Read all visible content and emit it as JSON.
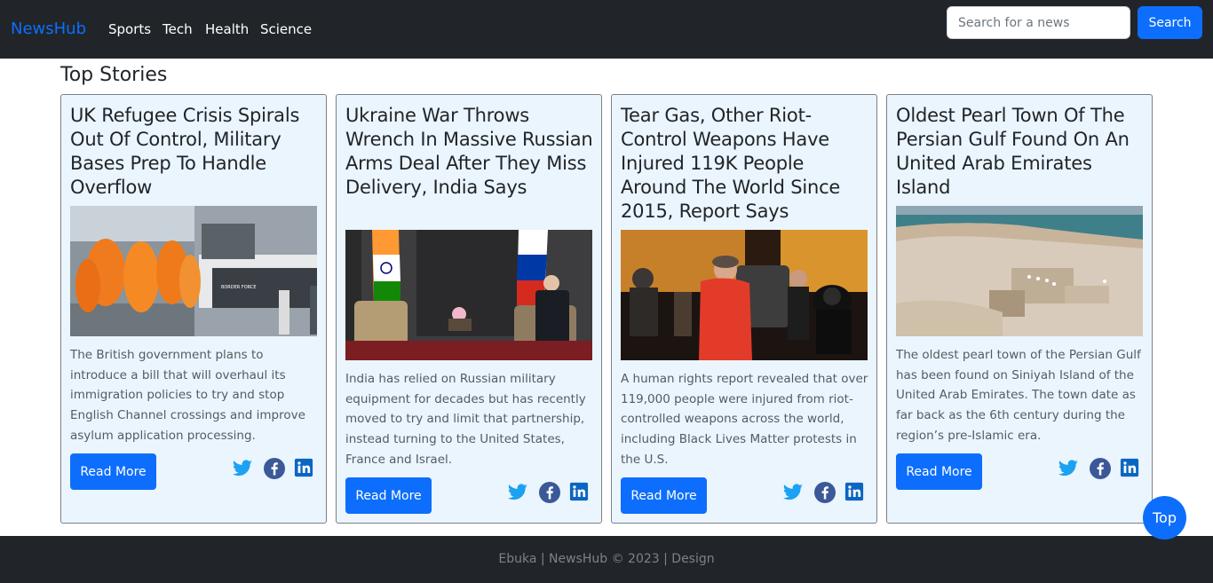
{
  "nav": {
    "brand": "NewsHub",
    "links": [
      "Sports",
      "Tech",
      "Health",
      "Science"
    ],
    "search_placeholder": "Search for a news",
    "search_button": "Search"
  },
  "section_title": "Top Stories",
  "cards": [
    {
      "title": "UK Refugee Crisis Spirals Out Of Control, Military Bases Prep To Handle Overflow",
      "text": "The British government plans to introduce a bill that will overhaul its immigration policies to try and stop English Channel crossings and improve asylum application processing.",
      "button": "Read More",
      "image_sign": "BORDER FORCE"
    },
    {
      "title": "Ukraine War Throws Wrench In Massive Russian Arms Deal After They Miss Delivery, India Says",
      "text": "India has relied on Russian military equipment for decades but has recently moved to try and limit that partnership, instead turning to the United States, France and Israel.",
      "button": "Read More"
    },
    {
      "title": "Tear Gas, Other Riot-Control Weapons Have Injured 119K People Around The World Since 2015, Report Says",
      "text": "A human rights report revealed that over 119,000 people were injured from riot-controlled weapons across the world, including Black Lives Matter protests in the U.S.",
      "button": "Read More"
    },
    {
      "title": "Oldest Pearl Town Of The Persian Gulf Found On An United Arab Emirates Island",
      "text": "The oldest pearl town of the Persian Gulf has been found on Siniyah Island of the United Arab Emirates. The town date as far back as the 6th century during the region’s pre-Islamic era.",
      "button": "Read More"
    }
  ],
  "footer": {
    "text": "Ebuka | NewsHub © 2023 | Design"
  },
  "top_button": "Top",
  "colors": {
    "navbar": "#212529",
    "accent": "#0d6efd",
    "card_bg": "#ebf5fd",
    "twitter": "#1da1f2",
    "facebook": "#3b5998",
    "linkedin": "#0a66c2"
  },
  "icons": [
    "twitter-icon",
    "facebook-icon",
    "linkedin-icon"
  ]
}
